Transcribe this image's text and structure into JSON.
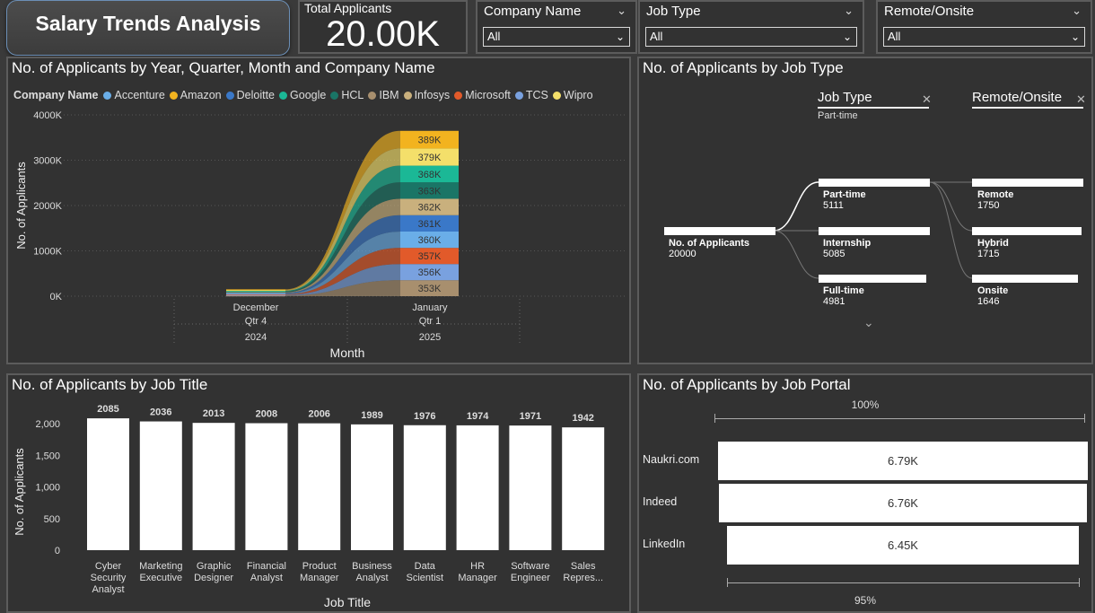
{
  "header": {
    "title": "Salary Trends Analysis"
  },
  "kpi": {
    "label": "Total Applicants",
    "value": "20.00K"
  },
  "slicers": [
    {
      "title": "Company Name",
      "value": "All"
    },
    {
      "title": "Job Type",
      "value": "All"
    },
    {
      "title": "Remote/Onsite",
      "value": "All"
    }
  ],
  "ribbon": {
    "title": "No. of Applicants by Year, Quarter, Month and Company Name",
    "legend_title": "Company Name",
    "legend": [
      {
        "name": "Accenture",
        "color": "#6aaee8"
      },
      {
        "name": "Amazon",
        "color": "#f2b31f"
      },
      {
        "name": "Deloitte",
        "color": "#3a78c8"
      },
      {
        "name": "Google",
        "color": "#1bb896"
      },
      {
        "name": "HCL",
        "color": "#1a7566"
      },
      {
        "name": "IBM",
        "color": "#a88f6e"
      },
      {
        "name": "Infosys",
        "color": "#c9b07d"
      },
      {
        "name": "Microsoft",
        "color": "#e25a2a"
      },
      {
        "name": "TCS",
        "color": "#79a1df"
      },
      {
        "name": "Wipro",
        "color": "#f4df6a"
      }
    ],
    "y_ticks": [
      "4000K",
      "3000K",
      "2000K",
      "1000K",
      "0K"
    ],
    "ylabel": "No. of Applicants",
    "xlabel": "Month",
    "x_groups": [
      {
        "month": "December",
        "quarter": "Qtr 4",
        "year": "2024"
      },
      {
        "month": "January",
        "quarter": "Qtr 1",
        "year": "2025"
      }
    ]
  },
  "chart_data": [
    {
      "type": "area",
      "title": "No. of Applicants by Year, Quarter, Month and Company Name",
      "xlabel": "Month",
      "ylabel": "No. of Applicants",
      "ylim": [
        0,
        4000000
      ],
      "categories": [
        "December 2024",
        "January 2025"
      ],
      "series": [
        {
          "name": "IBM",
          "values": [
            15000,
            353000
          ]
        },
        {
          "name": "TCS",
          "values": [
            15000,
            356000
          ]
        },
        {
          "name": "Microsoft",
          "values": [
            15000,
            357000
          ]
        },
        {
          "name": "Accenture",
          "values": [
            15000,
            360000
          ]
        },
        {
          "name": "Deloitte",
          "values": [
            15000,
            361000
          ]
        },
        {
          "name": "Infosys",
          "values": [
            15000,
            362000
          ]
        },
        {
          "name": "HCL",
          "values": [
            15000,
            363000
          ]
        },
        {
          "name": "Google",
          "values": [
            15000,
            368000
          ]
        },
        {
          "name": "Wipro",
          "values": [
            15000,
            379000
          ]
        },
        {
          "name": "Amazon",
          "values": [
            15000,
            389000
          ]
        }
      ],
      "data_labels": [
        "389K",
        "379K",
        "368K",
        "363K",
        "362K",
        "361K",
        "360K",
        "357K",
        "356K",
        "353K"
      ]
    },
    {
      "type": "bar",
      "title": "No. of Applicants by Job Title",
      "xlabel": "Job Title",
      "ylabel": "No. of Applicants",
      "ylim": [
        0,
        2200
      ],
      "categories": [
        "Cyber Security Analyst",
        "Marketing Executive",
        "Graphic Designer",
        "Financial Analyst",
        "Product Manager",
        "Business Analyst",
        "Data Scientist",
        "HR Manager",
        "Software Engineer",
        "Sales Repres..."
      ],
      "values": [
        2085,
        2036,
        2013,
        2008,
        2006,
        1989,
        1976,
        1974,
        1971,
        1942
      ],
      "y_ticks": [
        "2,000",
        "1,500",
        "1,000",
        "500",
        "0"
      ]
    },
    {
      "type": "bar",
      "title": "No. of Applicants by Job Portal",
      "categories": [
        "Naukri.com",
        "Indeed",
        "LinkedIn"
      ],
      "values": [
        6790,
        6760,
        6450
      ],
      "labels": [
        "6.79K",
        "6.76K",
        "6.45K"
      ],
      "top_percent": "100%",
      "bottom_percent": "95%"
    }
  ],
  "jobtype": {
    "title": "No. of Applicants by Job Type",
    "hdr1": "Job Type",
    "hdr1_sub": "Part-time",
    "hdr2": "Remote/Onsite",
    "root": {
      "label": "No. of Applicants",
      "value": "20000"
    },
    "level1": [
      {
        "label": "Part-time",
        "value": "5111"
      },
      {
        "label": "Internship",
        "value": "5085"
      },
      {
        "label": "Full-time",
        "value": "4981"
      }
    ],
    "level2": [
      {
        "label": "Remote",
        "value": "1750"
      },
      {
        "label": "Hybrid",
        "value": "1715"
      },
      {
        "label": "Onsite",
        "value": "1646"
      }
    ]
  },
  "jobtitle": {
    "title": "No. of Applicants by Job Title"
  },
  "portal": {
    "title": "No. of Applicants by Job Portal"
  }
}
